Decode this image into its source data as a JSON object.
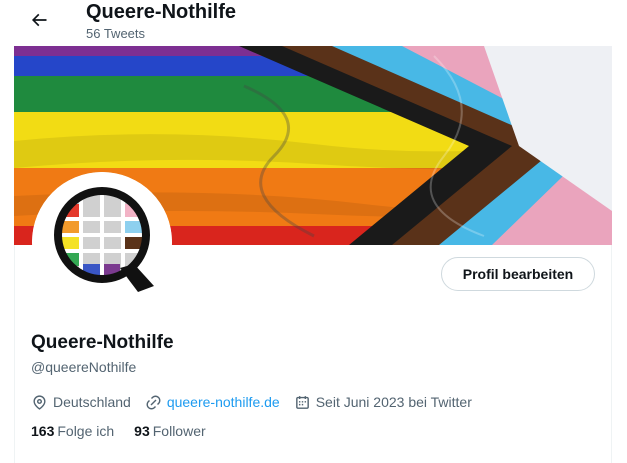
{
  "header": {
    "title": "Queere-Nothilfe",
    "tweet_count": "56 Tweets",
    "back_icon": "arrow-left-icon"
  },
  "banner": {
    "stripe_colors": [
      "#e40303",
      "#ff8c00",
      "#ffed00",
      "#008026",
      "#004dff",
      "#750787"
    ],
    "chevron_colors": [
      "#ffffff",
      "#f5a9b8",
      "#5bcefa",
      "#613915",
      "#000000"
    ]
  },
  "profile": {
    "name": "Queere-Nothilfe",
    "handle": "@queereNothilfe",
    "edit_label": "Profil bearbeiten",
    "location": "Deutschland",
    "website": "queere-nothilfe.de",
    "joined": "Seit Juni 2023 bei Twitter",
    "following_count": "163",
    "following_label": "Folge ich",
    "followers_count": "93",
    "followers_label": "Follower"
  },
  "colors": {
    "accent": "#1d9bf0",
    "text": "#0f1419",
    "muted": "#536471"
  }
}
